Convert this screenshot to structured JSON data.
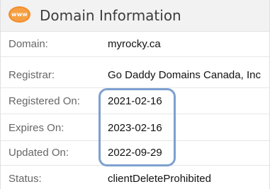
{
  "header": {
    "icon_text": "www",
    "icon_name": "www-globe-icon",
    "title": "Domain Information"
  },
  "rows": [
    {
      "label": "Domain:",
      "value": "myrocky.ca"
    },
    {
      "label": "Registrar:",
      "value": "Go Daddy Domains Canada, Inc"
    },
    {
      "label": "Registered On:",
      "value": "2021-02-16"
    },
    {
      "label": "Expires On:",
      "value": "2023-02-16"
    },
    {
      "label": "Updated On:",
      "value": "2022-09-29"
    },
    {
      "label": "Status:",
      "value": "clientDeleteProhibited"
    }
  ],
  "colors": {
    "icon_orange": "#f28c28",
    "highlight_blue": "#7da0d0",
    "header_bg": "#f2f2f2"
  }
}
